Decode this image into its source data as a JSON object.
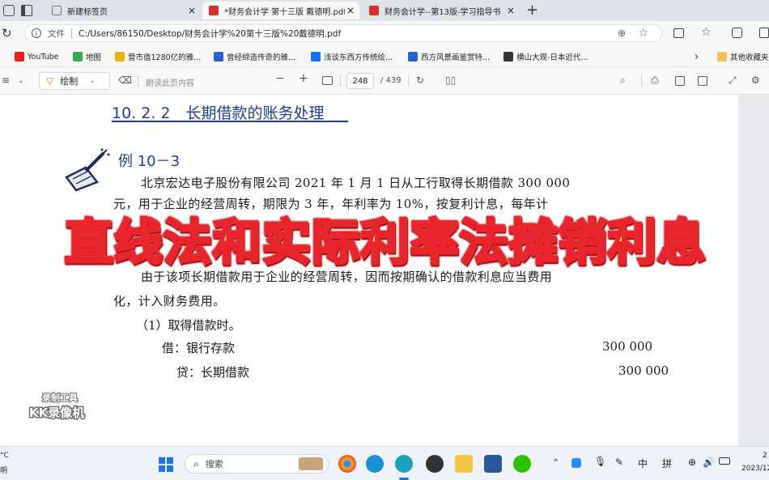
{
  "tabs": [
    {
      "label": "新建标签页",
      "active": false
    },
    {
      "label": "*财务会计学 第十三版 戴德明.pdf",
      "active": true
    },
    {
      "label": "财务会计学--第13版-学习指导书",
      "active": false
    }
  ],
  "address": {
    "prefix": "文件",
    "url": "C:/Users/86150/Desktop/财务会计学%20第十三版%20戴德明.pdf"
  },
  "bookmarks": [
    "YouTube",
    "地图",
    "营市值1280亿的雅...",
    "曾经缔造传奇的雅...",
    "浅谈东西方传统绘...",
    "西方风景画鉴赏特...",
    "横山大观-日本近代...",
    "其他收藏夹"
  ],
  "pdf_toolbar": {
    "draw_label": "绘制",
    "read_aloud": "朗读此页内容",
    "current_page": "248",
    "total_pages": "/ 439"
  },
  "document": {
    "section_heading": "10. 2. 2　长期借款的账务处理",
    "example_label": "例 10－3",
    "para1_line1": "北京宏达电子股份有限公司 2021 年 1 月 1 日从工行取得长期借款 300 000",
    "para1_line2": "元，用于企业的经营周转，期限为 3 年，年利率为 10%，按复利计息，每年计",
    "para2_line1": "由于该项长期借款用于企业的经营周转，因而按期确认的借款利息应当费用",
    "para2_line2": "化，计入财务费用。",
    "step1": "（1）取得借款时。",
    "debit_label": "借：银行存款",
    "debit_amount": "300 000",
    "credit_label": "贷：长期借款",
    "credit_amount": "300 000"
  },
  "overlay_title": "直线法和实际利率法摊销利息",
  "watermark": {
    "line1": "录制工具",
    "line2": "KK录像机"
  },
  "taskbar": {
    "search": "搜索",
    "ime1": "中",
    "ime2": "拼",
    "clock_time": "2",
    "clock_date": "2023/12"
  },
  "corner_left": {
    "line1": "°C",
    "line2": "明"
  }
}
